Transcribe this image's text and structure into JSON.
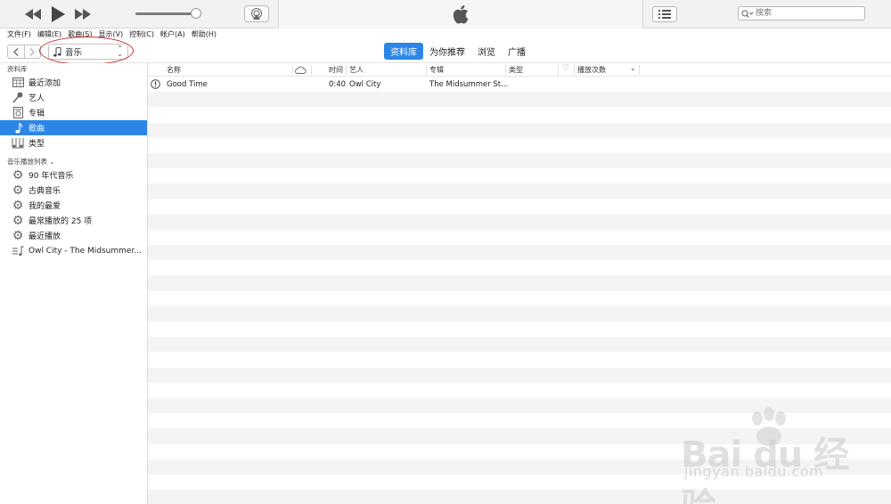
{
  "search": {
    "placeholder": "搜索"
  },
  "menu": [
    "文件(F)",
    "编辑(E)",
    "歌曲(S)",
    "显示(V)",
    "控制(C)",
    "帐户(A)",
    "帮助(H)"
  ],
  "media_select": {
    "label": "音乐"
  },
  "tabs": [
    "资料库",
    "为你推荐",
    "浏览",
    "广播"
  ],
  "sidebar": {
    "library_heading": "资料库",
    "library_items": [
      "最近添加",
      "艺人",
      "专辑",
      "歌曲",
      "类型"
    ],
    "playlists_heading": "音乐播放列表 ⌄",
    "playlist_items": [
      "90 年代音乐",
      "古典音乐",
      "我的最爱",
      "最常播放的 25 项",
      "最近播放",
      "Owl City - The Midsummer..."
    ]
  },
  "columns": {
    "name": "名称",
    "time": "时间",
    "artist": "艺人",
    "album": "专辑",
    "genre": "类型",
    "plays": "播放次数"
  },
  "songs": [
    {
      "name": "Good Time",
      "time": "0:40",
      "artist": "Owl City",
      "album": "The Midsummer St..."
    }
  ],
  "watermark": {
    "brand": "Bai du 经验",
    "site": "jingyan.baidu.com"
  },
  "colors": {
    "accent": "#2b86e6",
    "highlight_ellipse": "#c8302c"
  }
}
